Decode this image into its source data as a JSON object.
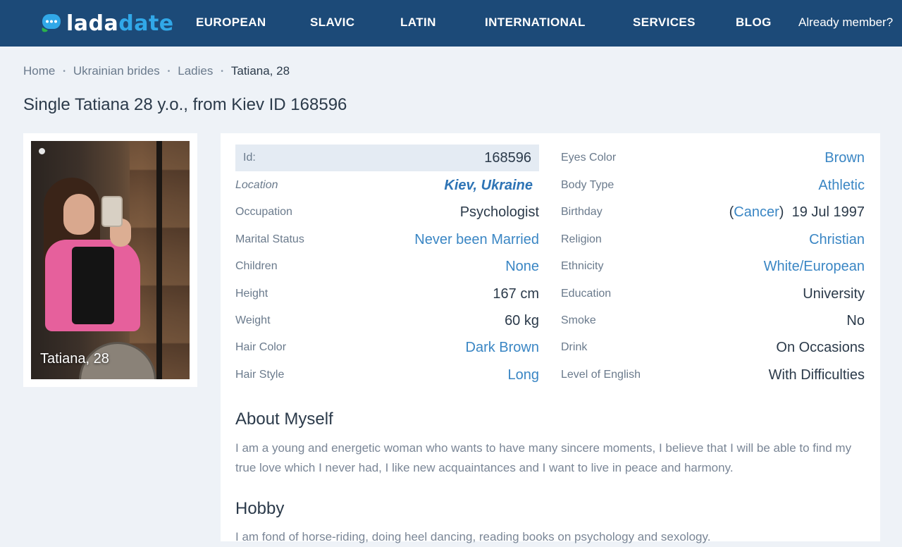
{
  "header": {
    "logo_part1": "lada",
    "logo_part2": "date",
    "nav": [
      "EUROPEAN",
      "SLAVIC",
      "LATIN",
      "INTERNATIONAL",
      "SERVICES",
      "BLOG"
    ],
    "member_link": "Already member?"
  },
  "breadcrumb": {
    "items": [
      "Home",
      "Ukrainian brides",
      "Ladies"
    ],
    "current": "Tatiana, 28",
    "separator": "•"
  },
  "page_title": "Single Tatiana 28 y.o., from Kiev ID 168596",
  "photo": {
    "caption": "Tatiana, 28",
    "icon": "photo-indicator-dot"
  },
  "profile_left": [
    {
      "label": "Id:",
      "value": "168596"
    },
    {
      "label": "Location",
      "value": "Kiev, Ukraine"
    },
    {
      "label": "Occupation",
      "value": "Psychologist"
    },
    {
      "label": "Marital Status",
      "value": "Never been Married"
    },
    {
      "label": "Children",
      "value": "None"
    },
    {
      "label": "Height",
      "value": "167 cm"
    },
    {
      "label": "Weight",
      "value": "60 kg"
    },
    {
      "label": "Hair Color",
      "value": "Dark Brown"
    },
    {
      "label": "Hair Style",
      "value": "Long"
    }
  ],
  "profile_right": [
    {
      "label": "Eyes Color",
      "value": "Brown"
    },
    {
      "label": "Body Type",
      "value": "Athletic"
    },
    {
      "label": "Birthday",
      "zodiac_open": "(",
      "zodiac": "Cancer",
      "zodiac_close": ")",
      "date": "19 Jul 1997"
    },
    {
      "label": "Religion",
      "value": "Christian"
    },
    {
      "label": "Ethnicity",
      "value": "White/European"
    },
    {
      "label": "Education",
      "value": "University"
    },
    {
      "label": "Smoke",
      "value": "No"
    },
    {
      "label": "Drink",
      "value": "On Occasions"
    },
    {
      "label": "Level of English",
      "value": "With Difficulties"
    }
  ],
  "about": {
    "title": "About Myself",
    "text": "I am a young and energetic woman who wants to have many sincere moments, I believe that I will be able to find my true love which I never had, I like new acquaintances and I want to live in peace and harmony."
  },
  "hobby": {
    "title": "Hobby",
    "text": "I am fond of horse-riding, doing heel dancing, reading books on psychology and sexology."
  },
  "colors": {
    "header_bg": "#1c4a78",
    "logo_accent": "#31a8e8",
    "link": "#3a86c4",
    "page_bg": "#eef2f7"
  }
}
